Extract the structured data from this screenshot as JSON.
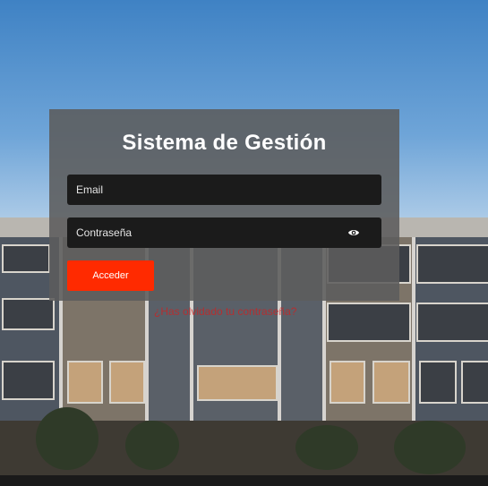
{
  "login": {
    "title": "Sistema de Gestión",
    "email_placeholder": "Email",
    "password_placeholder": "Contraseña",
    "submit_label": "Acceder",
    "forgot_label": "¿Has olvidado tu contraseña?",
    "password_toggle_icon": "eye-icon"
  },
  "colors": {
    "panel_bg": "#5c5c5c",
    "input_bg": "#1b1b1b",
    "button_bg": "#ff2a00",
    "link_color": "#d11f1f"
  }
}
